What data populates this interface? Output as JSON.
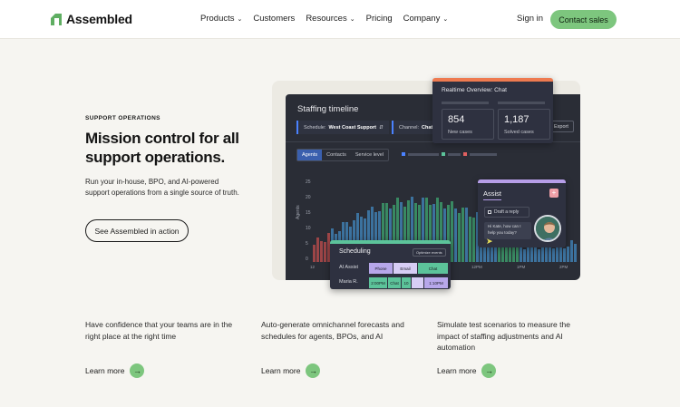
{
  "nav": {
    "logo": "Assembled",
    "links": [
      {
        "label": "Products",
        "dropdown": true
      },
      {
        "label": "Customers",
        "dropdown": false
      },
      {
        "label": "Resources",
        "dropdown": true
      },
      {
        "label": "Pricing",
        "dropdown": false
      },
      {
        "label": "Company",
        "dropdown": true
      }
    ],
    "sign_in": "Sign in",
    "contact": "Contact sales"
  },
  "hero": {
    "eyebrow": "SUPPORT OPERATIONS",
    "title": "Mission control for all support operations.",
    "description": "Run your in-house, BPO, and AI-powered support operations from a single source of truth.",
    "cta": "See Assembled in action"
  },
  "dashboard": {
    "title": "Staffing timeline",
    "schedule_label": "Schedule:",
    "schedule_value": "West Coast Support",
    "channel_label": "Channel:",
    "channel_value": "Chat",
    "export": "Export",
    "tabs": [
      "Agents",
      "Contacts",
      "Service level"
    ],
    "y_label": "Agents",
    "y_ticks": [
      "25",
      "20",
      "15",
      "10",
      "5",
      "0"
    ],
    "x_ticks": [
      "12",
      "12PM",
      "1PM",
      "2PM"
    ]
  },
  "realtime": {
    "title": "Realtime Overview: Chat",
    "new_cases_value": "854",
    "new_cases_label": "New cases",
    "solved_value": "1,187",
    "solved_label": "Solved cases"
  },
  "assist": {
    "title": "Assist",
    "draft": "Draft a reply",
    "message": "Hi Kate, how can I help you today?"
  },
  "scheduling": {
    "title": "Scheduling",
    "optimize": "Optimize events",
    "rows": [
      {
        "name": "AI Assist",
        "segments": [
          "Phone",
          "Email",
          "Chat"
        ]
      },
      {
        "name": "Maria R.",
        "segments": [
          "2:00PM",
          "Chat",
          "10",
          "1:10PM"
        ]
      }
    ]
  },
  "features": [
    {
      "text": "Have confidence that your teams are in the right place at the right time",
      "link": "Learn more"
    },
    {
      "text": "Auto-generate omnichannel forecasts and schedules for agents, BPOs, and AI",
      "link": "Learn more"
    },
    {
      "text": "Simulate test scenarios to measure the impact of staffing adjustments and AI automation",
      "link": "Learn more"
    }
  ],
  "colors": {
    "accent_green": "#7dc67e",
    "dashboard_bg": "#2a2d36",
    "realtime_border": "#ee7a50",
    "assist_border": "#b69ee8",
    "scheduling_border": "#5cc39a"
  }
}
